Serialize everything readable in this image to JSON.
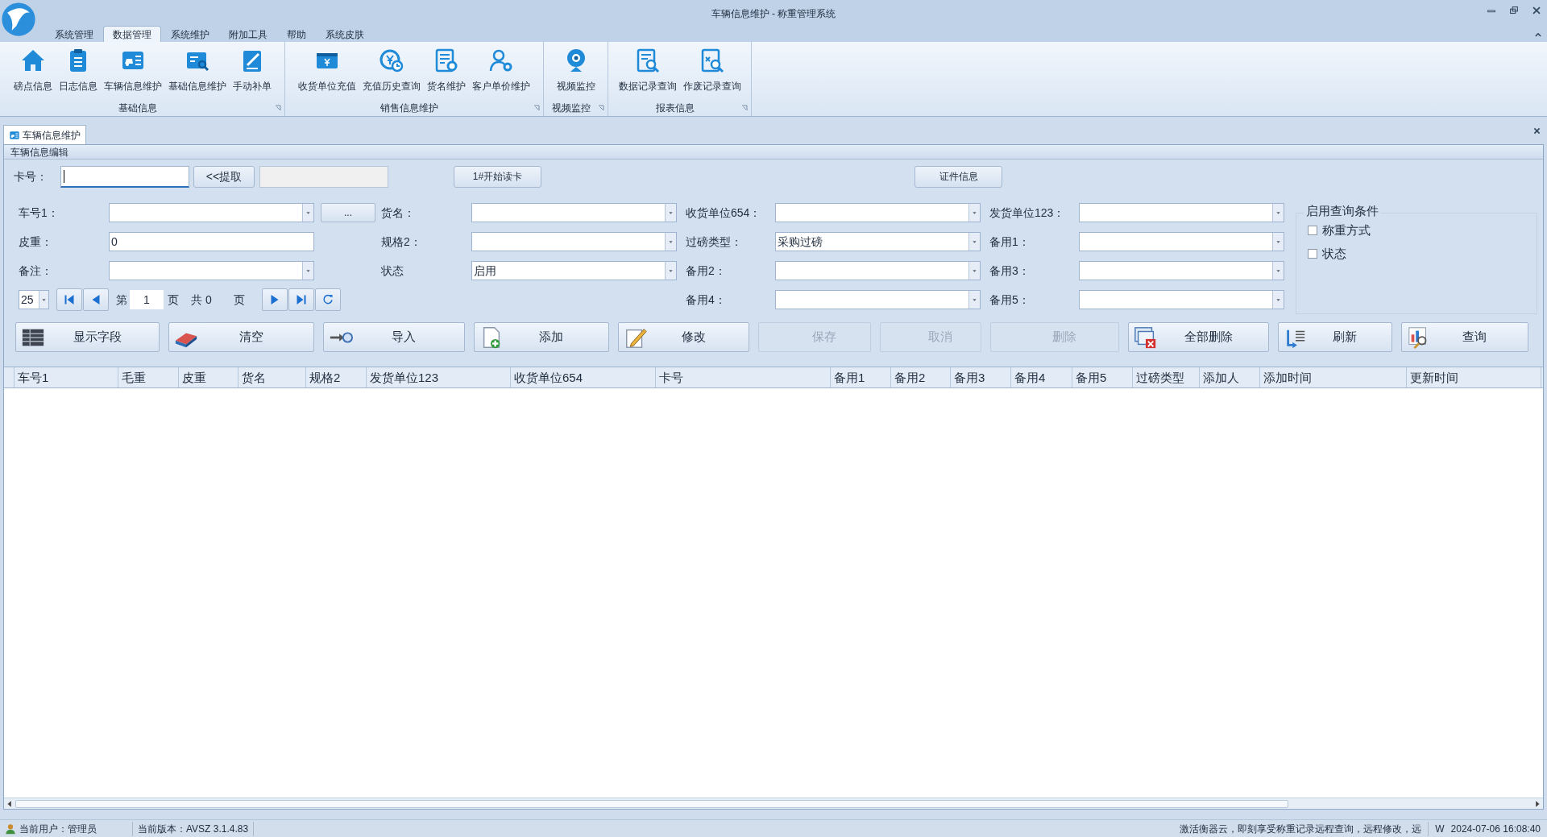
{
  "window": {
    "title": "车辆信息维护 - 称重管理系统"
  },
  "ribbon_tabs": [
    {
      "label": "系统管理",
      "selected": false
    },
    {
      "label": "数据管理",
      "selected": true
    },
    {
      "label": "系统维护",
      "selected": false
    },
    {
      "label": "附加工具",
      "selected": false
    },
    {
      "label": "帮助",
      "selected": false
    },
    {
      "label": "系统皮肤",
      "selected": false
    }
  ],
  "ribbon_groups": [
    {
      "label": "基础信息",
      "items": [
        {
          "label": "磅点信息"
        },
        {
          "label": "日志信息"
        },
        {
          "label": "车辆信息维护"
        },
        {
          "label": "基础信息维护"
        },
        {
          "label": "手动补单"
        }
      ]
    },
    {
      "label": "销售信息维护",
      "items": [
        {
          "label": "收货单位充值"
        },
        {
          "label": "充值历史查询"
        },
        {
          "label": "货名维护"
        },
        {
          "label": "客户单价维护"
        }
      ]
    },
    {
      "label": "视频监控",
      "items": [
        {
          "label": "视频监控"
        }
      ]
    },
    {
      "label": "报表信息",
      "items": [
        {
          "label": "数据记录查询"
        },
        {
          "label": "作废记录查询"
        }
      ]
    }
  ],
  "document_tabs": [
    {
      "label": "车辆信息维护",
      "selected": true
    }
  ],
  "panel": {
    "title": "车辆信息编辑",
    "card_row": {
      "label": "卡号：",
      "fetch_button": "<<提取",
      "read_button": "1#开始读卡",
      "cert_button": "证件信息"
    },
    "rows": [
      {
        "cells": [
          {
            "kind": "combo",
            "label": "车号1：",
            "button": "..."
          },
          {
            "kind": "combo",
            "label": "货名："
          },
          {
            "kind": "combo",
            "label": "收货单位654："
          },
          {
            "kind": "combo",
            "label": "发货单位123："
          }
        ]
      },
      {
        "cells": [
          {
            "kind": "text",
            "label": "皮重：",
            "value": "0"
          },
          {
            "kind": "combo",
            "label": "规格2："
          },
          {
            "kind": "combo",
            "label": "过磅类型：",
            "value": "采购过磅"
          },
          {
            "kind": "combo",
            "label": "备用1："
          }
        ]
      },
      {
        "cells": [
          {
            "kind": "combo",
            "label": "备注："
          },
          {
            "kind": "combo",
            "label": "状态",
            "value": "启用"
          },
          {
            "kind": "combo",
            "label": "备用2："
          },
          {
            "kind": "combo",
            "label": "备用3："
          }
        ]
      },
      {
        "cells": [
          {
            "kind": "pager",
            "page_size": "25",
            "page_prefix": "第",
            "page": "1",
            "page_suffix": "页",
            "total": "共 0",
            "total_suffix": "页"
          },
          {
            "kind": "blank"
          },
          {
            "kind": "combo",
            "label": "备用4："
          },
          {
            "kind": "combo",
            "label": "备用5："
          }
        ]
      }
    ],
    "query_conditions": {
      "title": "启用查询条件",
      "options": [
        {
          "label": "称重方式",
          "checked": false
        },
        {
          "label": "状态",
          "checked": false
        }
      ]
    },
    "actions": [
      {
        "label": "显示字段",
        "disabled": false
      },
      {
        "label": "清空",
        "disabled": false
      },
      {
        "label": "导入",
        "disabled": false
      },
      {
        "label": "添加",
        "disabled": false
      },
      {
        "label": "修改",
        "disabled": false
      },
      {
        "label": "保存",
        "disabled": true
      },
      {
        "label": "取消",
        "disabled": true
      },
      {
        "label": "删除",
        "disabled": true
      },
      {
        "label": "全部删除",
        "disabled": false
      },
      {
        "label": "刷新",
        "disabled": false
      },
      {
        "label": "查询",
        "disabled": false
      }
    ]
  },
  "table": {
    "columns": [
      "车号1",
      "毛重",
      "皮重",
      "货名",
      "规格2",
      "发货单位123",
      "收货单位654",
      "卡号",
      "备用1",
      "备用2",
      "备用3",
      "备用4",
      "备用5",
      "过磅类型",
      "添加人",
      "添加时间",
      "更新时间"
    ]
  },
  "status_bar": {
    "user": "当前用户：管理员",
    "version": "当前版本：AVSZ 3.1.4.83",
    "message": "激活衡器云，即刻享受称重记录远程查询，远程修改，远",
    "mode": "W",
    "time": "2024-07-06 16:08:40"
  }
}
